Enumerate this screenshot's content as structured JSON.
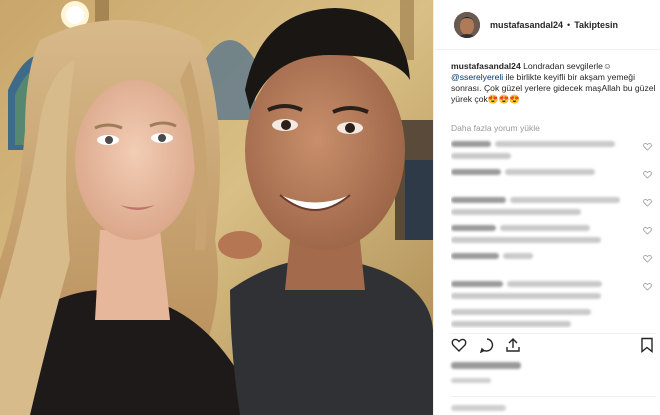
{
  "post": {
    "username": "mustafasandal24",
    "follow_status": "Takiptesin",
    "caption": {
      "user": "mustafasandal24",
      "before": " Londradan sevgilerle☺ ",
      "mention": "@sserelyereli",
      "after": " ile birlikte keyifli bir akşam yemeği sonrası. Çok güzel yerlere gidecek maşAllah bu güzel yürek çok😍😍😍"
    },
    "load_more_comments": "Daha fazla yorum yükle"
  },
  "icons": {
    "heart": "heart-icon",
    "comment": "comment-icon",
    "share": "share-icon",
    "bookmark": "bookmark-icon",
    "avatar": "avatar"
  },
  "colors": {
    "text": "#262626",
    "muted": "#999999",
    "mention": "#003569",
    "border": "#efefef"
  }
}
